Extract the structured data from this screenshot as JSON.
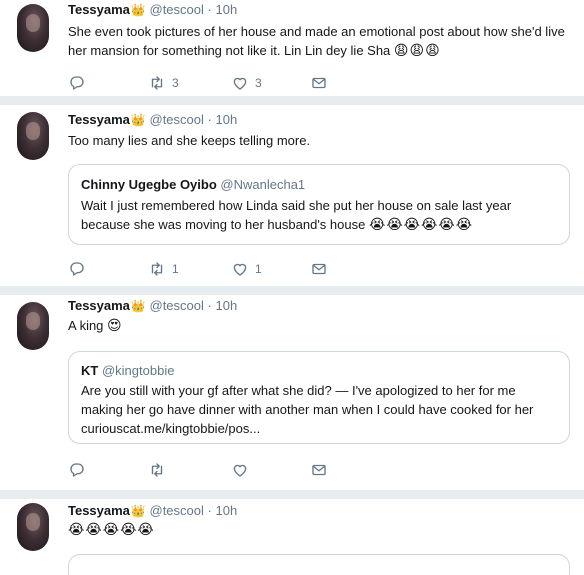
{
  "tweets": [
    {
      "name": "Tessyama",
      "crown": "👑",
      "handle": "@tescool",
      "dot": "·",
      "time": "10h",
      "text": "She even took pictures of her house and made an emotional post about how she'd live her mansion for something not like it. Lin Lin dey lie Sha",
      "emoji": "😩😩😩",
      "retweets": "3",
      "likes": "3"
    },
    {
      "name": "Tessyama",
      "crown": "👑",
      "handle": "@tescool",
      "dot": "·",
      "time": "10h",
      "text": "Too  many lies and she keeps telling more.",
      "quote": {
        "name": "Chinny Ugegbe Oyibo",
        "handle": "@Nwanlecha1",
        "text": "Wait I just remembered how Linda said she put her house on sale last year because she was moving to her husband's house",
        "emoji": "😭😭😭😭😭😭"
      },
      "retweets": "1",
      "likes": "1"
    },
    {
      "name": "Tessyama",
      "crown": "👑",
      "handle": "@tescool",
      "dot": "·",
      "time": "10h",
      "text": "A king",
      "emoji": "😍",
      "quote": {
        "name": "KT",
        "handle": "@kingtobbie",
        "text": "Are you still with your gf after what she did? — I've apologized to her for me making her go have dinner with another man when I could have cooked for her curiouscat.me/kingtobbie/pos..."
      }
    },
    {
      "name": "Tessyama",
      "crown": "👑",
      "handle": "@tescool",
      "dot": "·",
      "time": "10h",
      "emoji": "😭😭😭😭😭"
    }
  ],
  "icons": [
    "reply-icon",
    "retweet-icon",
    "like-icon",
    "message-icon"
  ],
  "colors": {
    "text": "#14171a",
    "muted": "#657786",
    "divider": "#e6ecf0",
    "border": "#ccd6dd"
  }
}
